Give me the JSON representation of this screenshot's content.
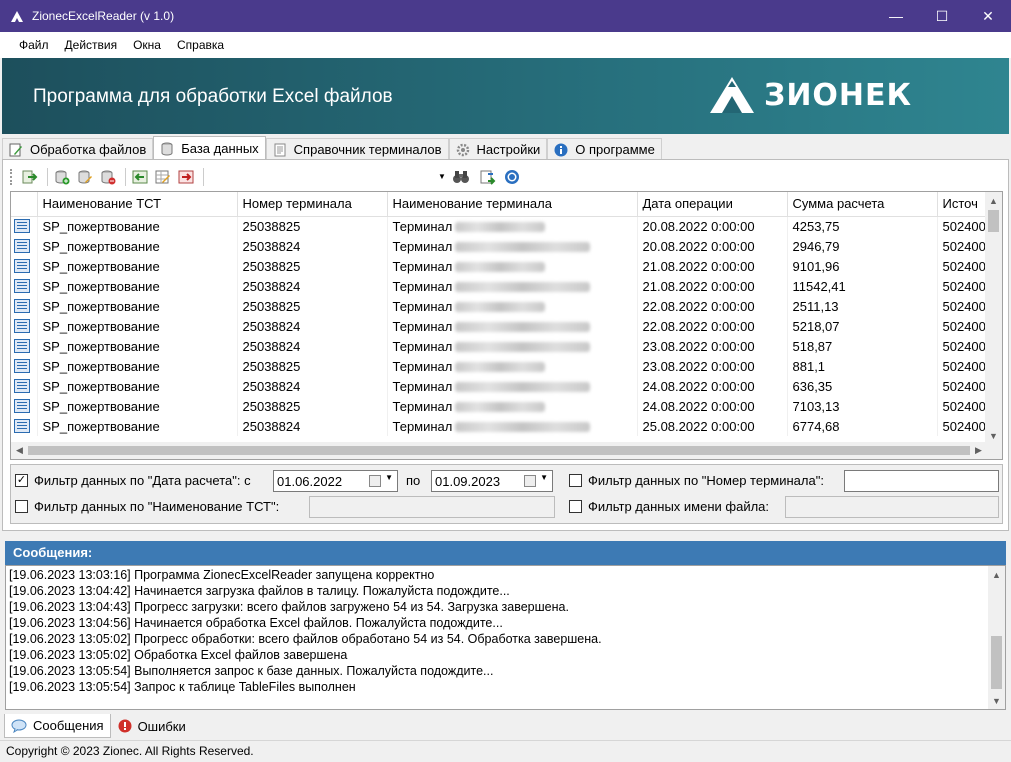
{
  "window": {
    "title": "ZionecExcelReader (v 1.0)",
    "minimize": "—",
    "maximize": "☐",
    "close": "✕"
  },
  "menu": [
    "Файл",
    "Действия",
    "Окна",
    "Справка"
  ],
  "banner": {
    "title": "Программа для обработки Excel файлов",
    "logo_text": "ЗИОНЕК"
  },
  "tabs": [
    {
      "label": "Обработка файлов",
      "icon": "file-edit-icon"
    },
    {
      "label": "База данных",
      "icon": "database-icon"
    },
    {
      "label": "Справочник терминалов",
      "icon": "document-icon"
    },
    {
      "label": "Настройки",
      "icon": "gear-icon"
    },
    {
      "label": "О программе",
      "icon": "info-icon"
    }
  ],
  "active_tab": "База данных",
  "grid": {
    "columns": [
      "",
      "Наименование ТСТ",
      "Номер терминала",
      "Наименование терминала",
      "Дата операции",
      "Сумма расчета",
      "Источ"
    ],
    "rows": [
      {
        "tst": "SP_пожертвование",
        "num": "25038825",
        "term": "Терминал",
        "date": "20.08.2022 0:00:00",
        "sum": "4253,75",
        "src": "502400"
      },
      {
        "tst": "SP_пожертвование",
        "num": "25038824",
        "term": "Терминал",
        "date": "20.08.2022 0:00:00",
        "sum": "2946,79",
        "src": "502400"
      },
      {
        "tst": "SP_пожертвование",
        "num": "25038825",
        "term": "Терминал",
        "date": "21.08.2022 0:00:00",
        "sum": "9101,96",
        "src": "502400"
      },
      {
        "tst": "SP_пожертвование",
        "num": "25038824",
        "term": "Терминал",
        "date": "21.08.2022 0:00:00",
        "sum": "11542,41",
        "src": "502400"
      },
      {
        "tst": "SP_пожертвование",
        "num": "25038825",
        "term": "Терминал",
        "date": "22.08.2022 0:00:00",
        "sum": "2511,13",
        "src": "502400"
      },
      {
        "tst": "SP_пожертвование",
        "num": "25038824",
        "term": "Терминал",
        "date": "22.08.2022 0:00:00",
        "sum": "5218,07",
        "src": "502400"
      },
      {
        "tst": "SP_пожертвование",
        "num": "25038824",
        "term": "Терминал",
        "date": "23.08.2022 0:00:00",
        "sum": "518,87",
        "src": "502400"
      },
      {
        "tst": "SP_пожертвование",
        "num": "25038825",
        "term": "Терминал",
        "date": "23.08.2022 0:00:00",
        "sum": "881,1",
        "src": "502400"
      },
      {
        "tst": "SP_пожертвование",
        "num": "25038824",
        "term": "Терминал",
        "date": "24.08.2022 0:00:00",
        "sum": "636,35",
        "src": "502400"
      },
      {
        "tst": "SP_пожертвование",
        "num": "25038825",
        "term": "Терминал",
        "date": "24.08.2022 0:00:00",
        "sum": "7103,13",
        "src": "502400"
      },
      {
        "tst": "SP_пожертвование",
        "num": "25038824",
        "term": "Терминал",
        "date": "25.08.2022 0:00:00",
        "sum": "6774,68",
        "src": "502400"
      }
    ]
  },
  "filters": {
    "date_label": "Фильтр данных по \"Дата расчета\": с",
    "date_checked": true,
    "date_from": "01.06.2022",
    "date_to_label": "по",
    "date_to": "01.09.2023",
    "terminal_num_label": "Фильтр данных по \"Номер терминала\":",
    "tst_name_label": "Фильтр данных по \"Наименование ТСТ\":",
    "file_name_label": "Фильтр данных имени файла:"
  },
  "messages": {
    "header": "Сообщения:",
    "lines": [
      "[19.06.2023 13:03:16] Программа ZionecExcelReader запущена корректно",
      "[19.06.2023 13:04:42] Начинается загрузка файлов в талицу. Пожалуйста подождите...",
      "[19.06.2023 13:04:43] Прогресс загрузки: всего файлов загружено 54 из 54. Загрузка завершена.",
      "[19.06.2023 13:04:56] Начинается обработка Excel файлов. Пожалуйста подождите...",
      "[19.06.2023 13:05:02] Прогресс обработки: всего файлов обработано 54 из 54. Обработка завершена.",
      "[19.06.2023 13:05:02] Обработка Excel файлов завершена",
      "[19.06.2023 13:05:54] Выполняется запрос к базе данных. Пожалуйста подождите...",
      "[19.06.2023 13:05:54] Запрос к таблице TableFiles выполнен"
    ]
  },
  "bottom_tabs": [
    {
      "label": "Сообщения",
      "icon": "speech-bubble-icon"
    },
    {
      "label": "Ошибки",
      "icon": "error-icon"
    }
  ],
  "status": "Copyright © 2023 Zionec. All Rights Reserved."
}
